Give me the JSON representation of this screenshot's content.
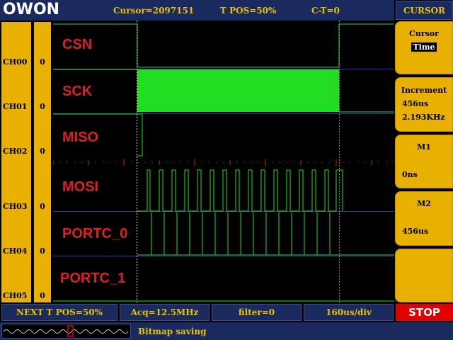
{
  "header": {
    "logo": "OWON",
    "cursor": "Cursor=2097151",
    "tpos": "T POS=50%",
    "ct": "C-T=0"
  },
  "menu": {
    "title": "CURSOR",
    "panels": [
      {
        "line1": "Cursor",
        "line2": "Time"
      },
      {
        "line1": "Increment",
        "line2": "456us",
        "line3": "2.193KHz"
      },
      {
        "line1": "M1",
        "line2": "0ns"
      },
      {
        "line1": "M2",
        "line2": "456us"
      },
      {
        "line1": ""
      }
    ]
  },
  "channels": [
    {
      "label": "CH00",
      "value": "0",
      "signal": "CSN"
    },
    {
      "label": "CH01",
      "value": "0",
      "signal": "SCK"
    },
    {
      "label": "CH02",
      "value": "0",
      "signal": "MISO"
    },
    {
      "label": "CH03",
      "value": "0",
      "signal": "MOSI"
    },
    {
      "label": "CH04",
      "value": "0",
      "signal": "PORTC_0"
    },
    {
      "label": "CH05",
      "value": "0",
      "signal": "PORTC_1"
    }
  ],
  "bottom": {
    "next_tpos": "NEXT T POS=50%",
    "acq": "Acq=12.5MHz",
    "filter": "filter=0",
    "timebase": "160us/div",
    "stop": "STOP"
  },
  "status": "Bitmap saving",
  "colors": {
    "panel_yellow": "#e8b000",
    "bar_blue": "#1b2a5e",
    "trace_green": "#22dd22",
    "signal_label_red": "#e02020",
    "stop_red": "#e00000"
  }
}
